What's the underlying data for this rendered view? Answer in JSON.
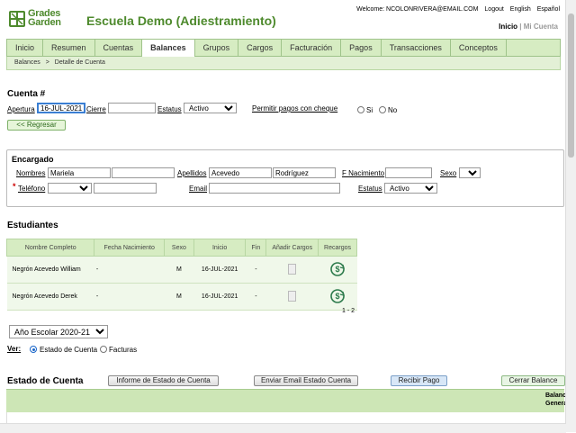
{
  "header": {
    "logo_line1": "Grades",
    "logo_line2": "Garden",
    "school_name": "Escuela Demo (Adiestramiento)",
    "welcome": "Welcome: NCOLONRIVERA@EMAIL.COM",
    "logout": "Logout",
    "english": "English",
    "spanish": "Español",
    "inicio": "Inicio",
    "separator": "|",
    "mi_cuenta": "Mi Cuenta"
  },
  "nav": {
    "tabs": [
      "Inicio",
      "Resumen",
      "Cuentas",
      "Balances",
      "Grupos",
      "Cargos",
      "Facturación",
      "Pagos",
      "Transacciones",
      "Conceptos"
    ],
    "active": "Balances"
  },
  "breadcrumb": {
    "root": "Balances",
    "sep": ">",
    "current": "Detalle de Cuenta"
  },
  "cuenta": {
    "title": "Cuenta #",
    "apertura_label": "Apertura",
    "apertura_value": "16-JUL-2021",
    "cierre_label": "Cierre",
    "cierre_value": "",
    "estatus_label": "Estatus",
    "estatus_value": "Activo",
    "permitir_label": "Permitir pagos con cheque",
    "si": "Si",
    "no": "No",
    "back_button": "<< Regresar"
  },
  "encargado": {
    "title": "Encargado",
    "nombres_label": "Nombres",
    "nombre1": "Mariela",
    "nombre2": "",
    "apellidos_label": "Apellidos",
    "apellido1": "Acevedo",
    "apellido2": "Rodríguez",
    "fnac_label": "F Nacimiento",
    "fnac_value": "",
    "sexo_label": "Sexo",
    "sexo_value": "",
    "required_mark": "*",
    "telefono_label": "Teléfono",
    "telefono_type": "",
    "telefono_value": "",
    "email_label": "Email",
    "email_value": "",
    "estatus_label": "Estatus",
    "estatus_value": "Activo"
  },
  "estudiantes": {
    "title": "Estudiantes",
    "columns": [
      "Nombre Completo",
      "Fecha Nacimiento",
      "Sexo",
      "Inicio",
      "Fin",
      "Añadir Cargos",
      "Recargos"
    ],
    "rows": [
      {
        "nombre": "Negrón Acevedo William",
        "fnac": "-",
        "sexo": "M",
        "inicio": "16-JUL-2021",
        "fin": "-"
      },
      {
        "nombre": "Negrón Acevedo Derek",
        "fnac": "-",
        "sexo": "M",
        "inicio": "16-JUL-2021",
        "fin": "-"
      }
    ],
    "pager": "1 - 2"
  },
  "ano": {
    "value": "Año Escolar 2020-21"
  },
  "ver": {
    "label": "Ver:",
    "opt1": "Estado de Cuenta",
    "opt2": "Facturas"
  },
  "estado": {
    "title": "Estado de Cuenta",
    "btn_informe": "Informe de Estado de Cuenta",
    "btn_email": "Enviar Email Estado Cuenta",
    "btn_recibir": "Recibir Pago",
    "btn_cerrar": "Cerrar Balance",
    "col_balance1": "Balanc",
    "col_balance2": "Genera"
  },
  "colors": {
    "brand_green": "#4e8a2d",
    "nav_bg": "#d6ecc2"
  }
}
